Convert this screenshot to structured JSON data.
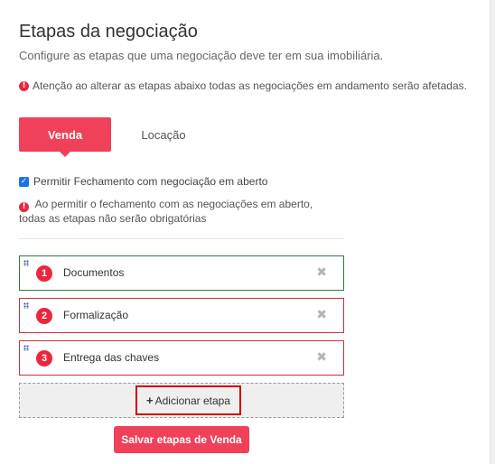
{
  "header": {
    "title": "Etapas da negociação",
    "subtitle": "Configure as etapas que uma negociação deve ter em sua imobiliária.",
    "warning": "Atenção ao alterar as etapas abaixo todas as negociações em andamento serão afetadas."
  },
  "tabs": {
    "active": "Venda",
    "inactive": "Locação"
  },
  "options": {
    "allow_close_label": "Permitir Fechamento com negociação em aberto",
    "allow_close_checked": true,
    "note_line1": "Ao permitir o fechamento com as negociações em aberto,",
    "note_line2": "todas as etapas não serão obrigatórias"
  },
  "steps": [
    {
      "number": "1",
      "label": "Documentos"
    },
    {
      "number": "2",
      "label": "Formalização"
    },
    {
      "number": "3",
      "label": "Entrega das chaves"
    }
  ],
  "actions": {
    "add_step": "Adicionar etapa",
    "save": "Salvar etapas de Venda"
  },
  "colors": {
    "accent": "#f0405a",
    "first_step_border": "#2d7a3a",
    "step_border": "#c9303f"
  },
  "icons": {
    "warning": "exclamation-circle-icon",
    "remove": "close-icon",
    "drag": "drag-handle-icon",
    "add": "plus-icon"
  }
}
